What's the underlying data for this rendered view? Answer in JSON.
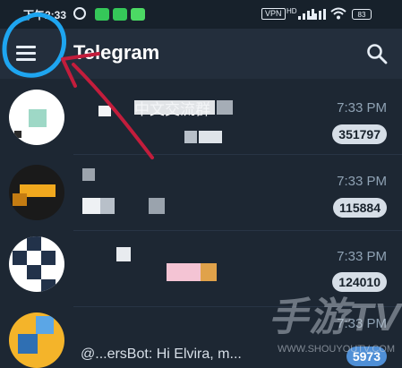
{
  "status_bar": {
    "time": "下午2:33",
    "vpn": "VPN",
    "network": "HD",
    "battery": "83"
  },
  "app_bar": {
    "title": "Telegram"
  },
  "colors": {
    "annotation_red": "#c31d3c",
    "annotation_blue": "#1ea5f0",
    "badge_bg": "#d6dee7",
    "appbar": "#232e3c",
    "list_bg": "#1d2733"
  },
  "icons": {
    "menu": "hamburger-menu-icon",
    "search": "search-icon"
  },
  "chats": [
    {
      "title": "中文交流群",
      "preview": "",
      "time": "7:33 PM",
      "unread": "351797"
    },
    {
      "title": "",
      "preview": "",
      "time": "7:33 PM",
      "unread": "115884"
    },
    {
      "title": "",
      "preview": "",
      "time": "7:33 PM",
      "unread": "124010"
    },
    {
      "title": "",
      "preview": "@...ersBot: Hi Elvira, m...",
      "time": "7:33 PM",
      "unread": "5973"
    }
  ],
  "watermark": {
    "text": "手游TV",
    "url": "WWW.SHOUYOUTV.COM"
  }
}
